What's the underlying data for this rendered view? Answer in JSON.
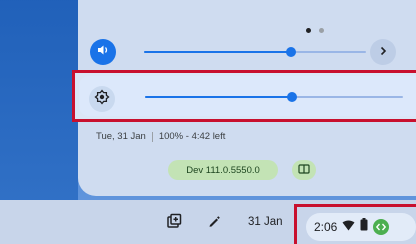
{
  "quick_settings": {
    "pager": {
      "pages": 2,
      "active_page": 1
    },
    "volume": {
      "icon": "speaker-icon",
      "level": 0.66
    },
    "brightness": {
      "icon": "brightness-icon",
      "level": 0.57
    },
    "date_label": "Tue, 31 Jan",
    "battery_label": "100% - 4:42 left",
    "version_label": "Dev 111.0.5550.0",
    "feedback_icon": "feedback-icon"
  },
  "shelf": {
    "date": "31 Jan",
    "screen_capture_icon": "screen-capture-icon",
    "stylus_icon": "stylus-icon",
    "tray": {
      "time": "2:06",
      "icons": [
        "wifi-icon",
        "battery-icon",
        "dev-channel-icon"
      ]
    }
  },
  "colors": {
    "accent": "#1a73e8",
    "highlight_border": "#c8102e",
    "panel": "#cfdcf0",
    "version_chip": "#c3e3b5"
  }
}
